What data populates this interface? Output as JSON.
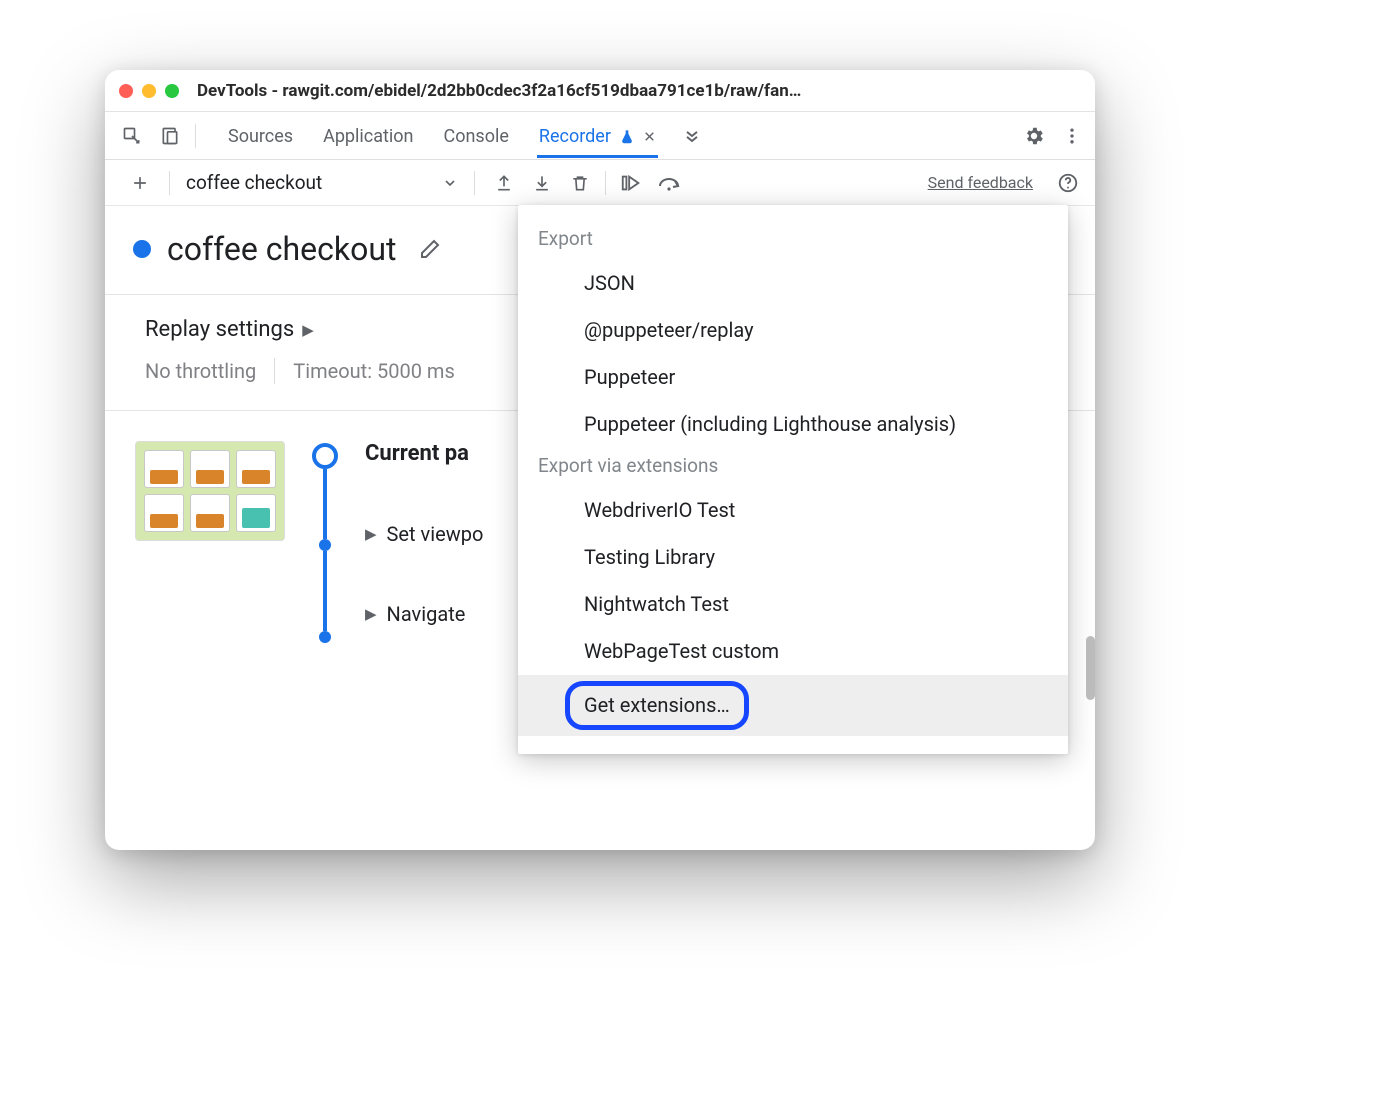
{
  "window": {
    "title": "DevTools - rawgit.com/ebidel/2d2bb0cdec3f2a16cf519dbaa791ce1b/raw/fan…"
  },
  "tabs": {
    "items": [
      "Sources",
      "Application",
      "Console",
      "Recorder"
    ],
    "active": "Recorder"
  },
  "toolbar": {
    "recording_name": "coffee checkout",
    "send_feedback": "Send feedback"
  },
  "recording": {
    "title": "coffee checkout"
  },
  "settings": {
    "heading": "Replay settings",
    "throttling": "No throttling",
    "timeout": "Timeout: 5000 ms"
  },
  "steps": {
    "current_page_label": "Current pa",
    "set_viewport_label": "Set viewpo",
    "navigate_label": "Navigate"
  },
  "dropdown": {
    "section_export": "Export",
    "export_items": [
      "JSON",
      "@puppeteer/replay",
      "Puppeteer",
      "Puppeteer (including Lighthouse analysis)"
    ],
    "section_extensions": "Export via extensions",
    "ext_items": [
      "WebdriverIO Test",
      "Testing Library",
      "Nightwatch Test",
      "WebPageTest custom"
    ],
    "get_extensions": "Get extensions…"
  }
}
